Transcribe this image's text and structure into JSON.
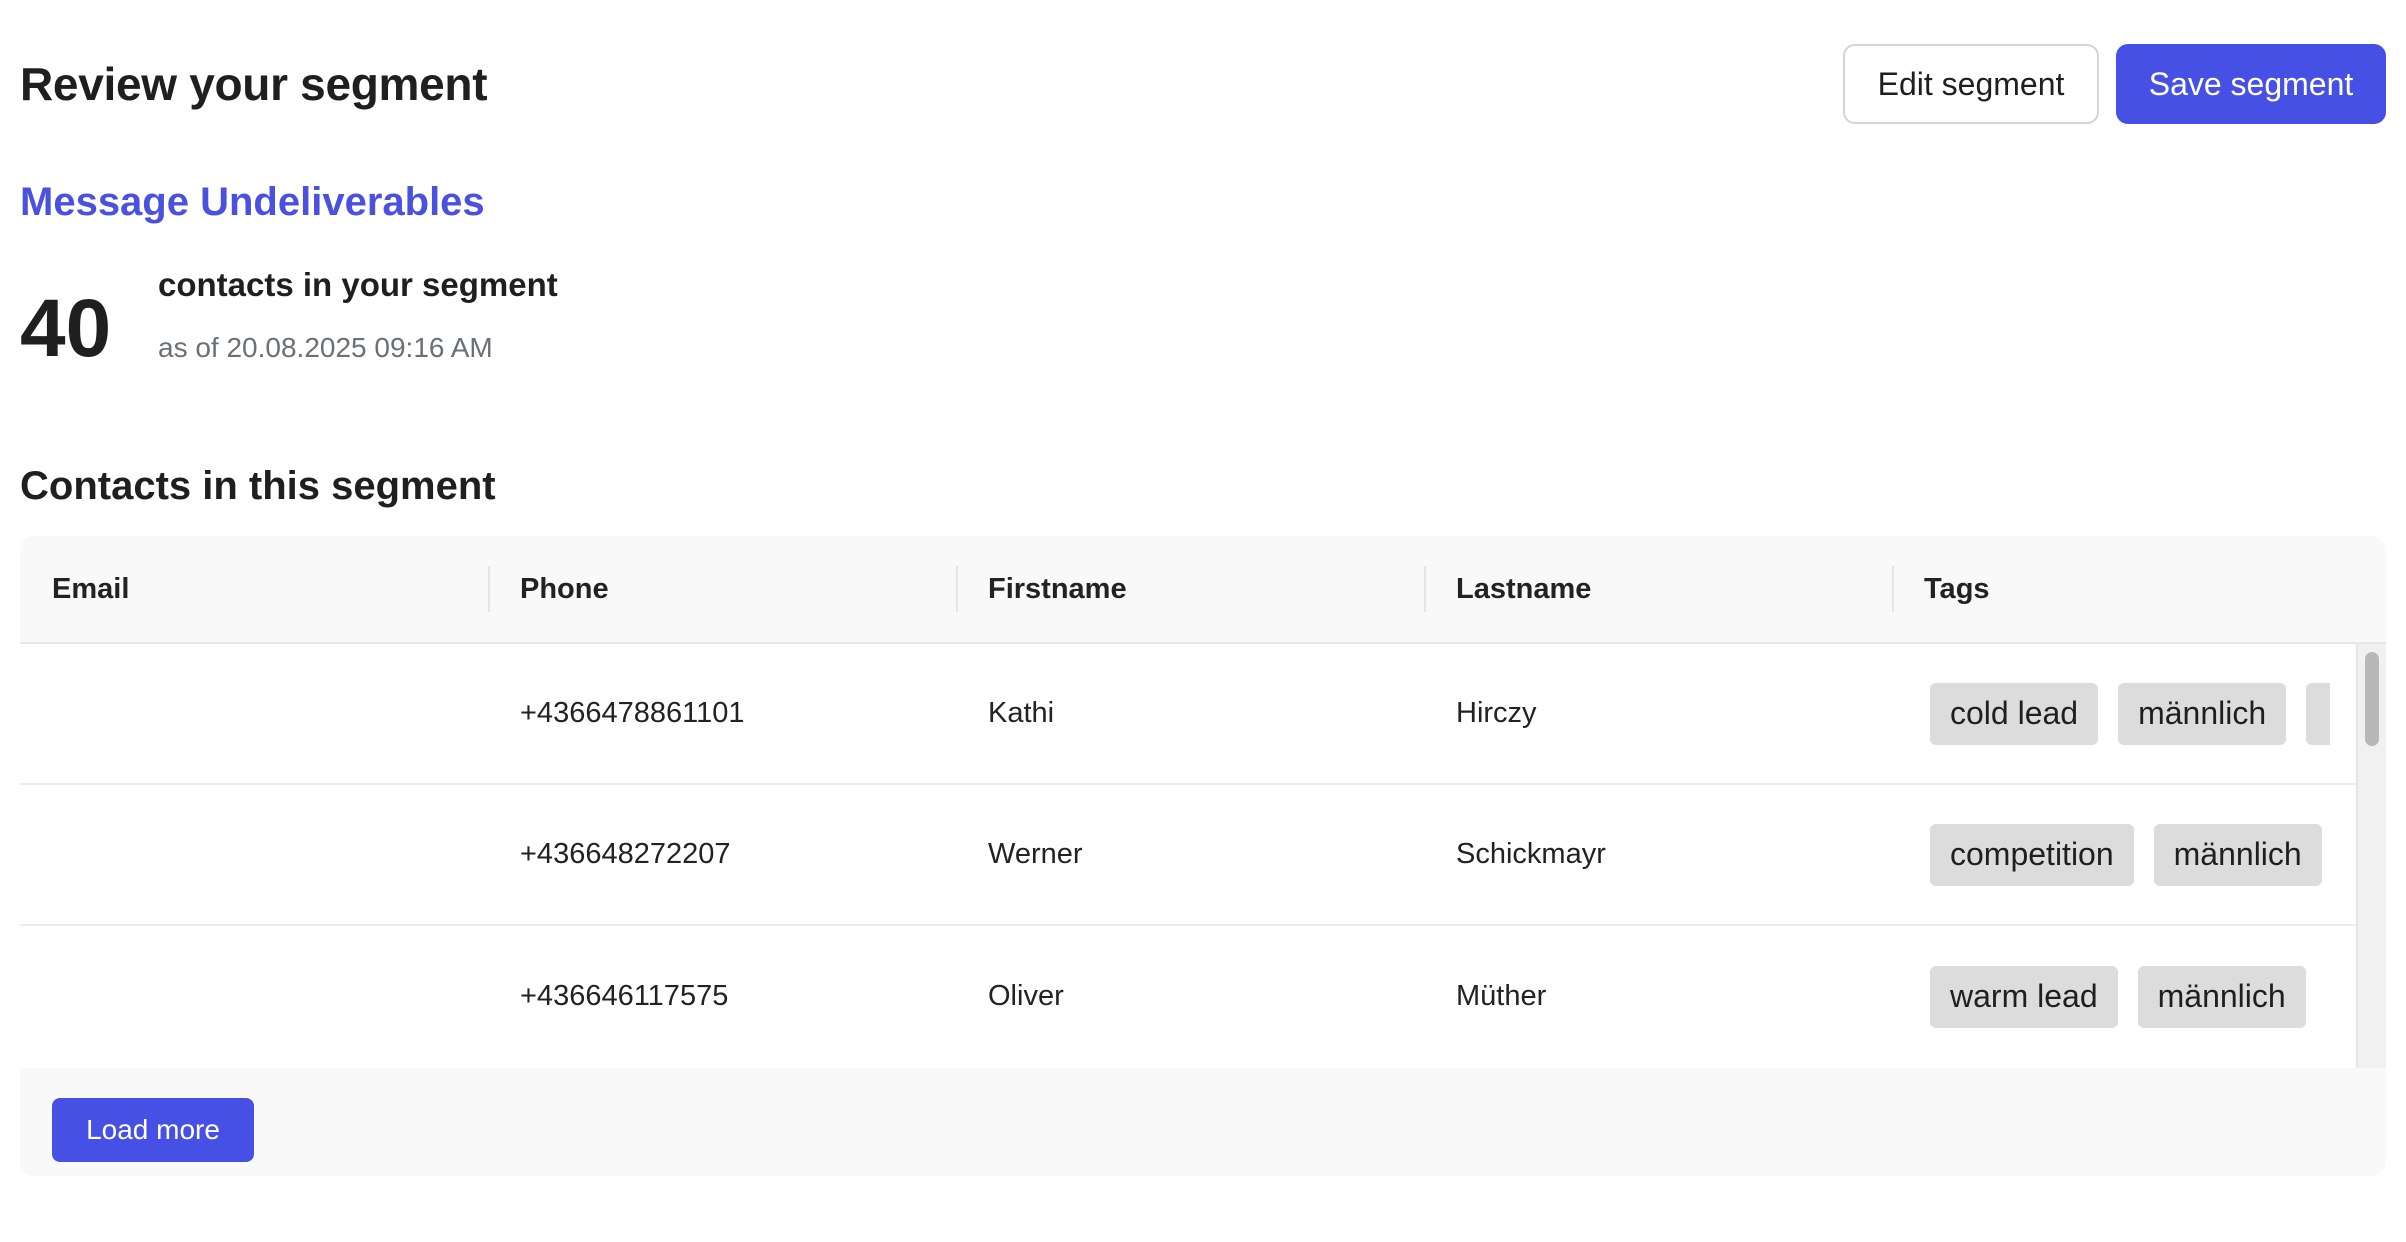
{
  "header": {
    "title": "Review your segment",
    "edit_label": "Edit segment",
    "save_label": "Save segment"
  },
  "segment": {
    "name": "Message Undeliverables",
    "count": "40",
    "count_label": "contacts in your segment",
    "as_of": "as of 20.08.2025 09:16 AM"
  },
  "contacts": {
    "section_title": "Contacts in this segment",
    "columns": [
      "Email",
      "Phone",
      "Firstname",
      "Lastname",
      "Tags"
    ],
    "rows": [
      {
        "email": "",
        "phone": "+4366478861101",
        "firstname": "Kathi",
        "lastname": "Hirczy",
        "tags": [
          "cold lead",
          "männlich",
          ""
        ]
      },
      {
        "email": "",
        "phone": "+436648272207",
        "firstname": "Werner",
        "lastname": "Schickmayr",
        "tags": [
          "competition",
          "männlich"
        ]
      },
      {
        "email": "",
        "phone": "+436646117575",
        "firstname": "Oliver",
        "lastname": "Müther",
        "tags": [
          "warm lead",
          "männlich"
        ]
      }
    ],
    "load_more_label": "Load more"
  },
  "colors": {
    "primary": "#4750e5",
    "segment_name": "#4a51de",
    "tag_bg": "#dcdcdc"
  }
}
